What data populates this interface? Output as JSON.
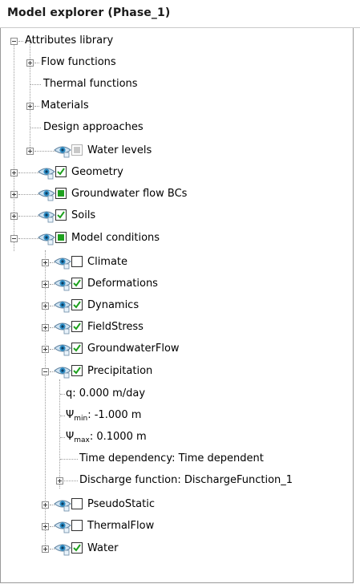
{
  "panel": {
    "title": "Model explorer (Phase_1)"
  },
  "tree": {
    "attributes_library": "Attributes library",
    "flow_functions": "Flow functions",
    "thermal_functions": "Thermal functions",
    "materials": "Materials",
    "design_approaches": "Design approaches",
    "water_levels": "Water levels",
    "geometry": "Geometry",
    "groundwater_flow_bcs": "Groundwater flow BCs",
    "soils": "Soils",
    "model_conditions": "Model conditions",
    "climate": "Climate",
    "deformations": "Deformations",
    "dynamics": "Dynamics",
    "fieldstress": "FieldStress",
    "groundwaterflow": "GroundwaterFlow",
    "precipitation": "Precipitation",
    "q": "q: 0.000 m/day",
    "psi_min_sym": "Ψ",
    "psi_min_sub": "min",
    "psi_min_val": ": -1.000 m",
    "psi_max_sym": "Ψ",
    "psi_max_sub": "max",
    "psi_max_val": ": 0.1000 m",
    "time_dependency": "Time dependency: Time dependent",
    "discharge_function": "Discharge function: DischargeFunction_1",
    "pseudostatic": "PseudoStatic",
    "thermalflow": "ThermalFlow",
    "water": "Water"
  },
  "states": {
    "water_levels": "disabled-filled",
    "geometry": "checked",
    "groundwater_flow_bcs": "filled",
    "soils": "checked",
    "model_conditions": "filled",
    "climate": "unchecked",
    "deformations": "checked",
    "dynamics": "checked",
    "fieldstress": "checked",
    "groundwaterflow": "checked",
    "precipitation": "checked",
    "pseudostatic": "unchecked",
    "thermalflow": "unchecked",
    "water": "checked"
  },
  "icons": {
    "visibility": "eye-icon",
    "expand": "plus-icon",
    "collapse": "minus-icon"
  },
  "colors": {
    "check": "#1ea01e",
    "eye": "#2d8fc8"
  }
}
